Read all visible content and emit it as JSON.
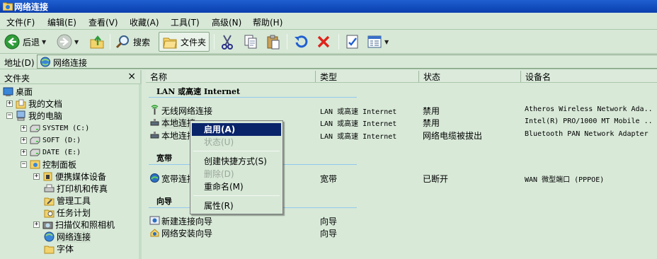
{
  "window": {
    "title": "网络连接",
    "icon": "network-folder-icon"
  },
  "menu": [
    "文件(F)",
    "编辑(E)",
    "查看(V)",
    "收藏(A)",
    "工具(T)",
    "高级(N)",
    "帮助(H)"
  ],
  "toolbar": {
    "back_label": "后退",
    "search_label": "搜索",
    "folders_label": "文件夹"
  },
  "address": {
    "label": "地址(D)",
    "value": "网络连接"
  },
  "folder_pane": {
    "title": "文件夹",
    "close": "×",
    "tree": [
      "桌面",
      "我的文档",
      "我的电脑",
      "SYSTEM (C:)",
      "SOFT (D:)",
      "DATE (E:)",
      "控制面板",
      "便携媒体设备",
      "打印机和传真",
      "管理工具",
      "任务计划",
      "扫描仪和照相机",
      "网络连接",
      "字体"
    ]
  },
  "columns": [
    "名称",
    "类型",
    "状态",
    "设备名"
  ],
  "groups": {
    "lan": "LAN 或高速 Internet",
    "broadband": "宽带",
    "wizard": "向导"
  },
  "rows": {
    "lan": [
      {
        "name": "无线网络连接",
        "type": "LAN 或高速 Internet",
        "status": "禁用",
        "device": "Atheros Wireless Network Ada..."
      },
      {
        "name": "本地连接",
        "type": "LAN 或高速 Internet",
        "status": "禁用",
        "device": "Intel(R) PRO/1000 MT Mobile ..."
      },
      {
        "name": "本地连接",
        "type": "LAN 或高速 Internet",
        "status": "网络电缆被拔出",
        "device": "Bluetooth PAN Network Adapter"
      }
    ],
    "broadband": [
      {
        "name": "宽带连接",
        "type": "宽带",
        "status": "已断开",
        "device": "WAN 微型端口 (PPPOE)"
      }
    ],
    "wizard": [
      {
        "name": "新建连接向导",
        "type": "向导"
      },
      {
        "name": "网络安装向导",
        "type": "向导"
      }
    ]
  },
  "context_menu": {
    "enable": "启用(A)",
    "status": "状态(U)",
    "shortcut": "创建快捷方式(S)",
    "delete": "删除(D)",
    "rename": "重命名(M)",
    "properties": "属性(R)"
  },
  "colors": {
    "title_bar": "#0a3fae",
    "background": "#d8e9d8",
    "highlight": "#0a246a",
    "group_line": "#93c9ea"
  }
}
